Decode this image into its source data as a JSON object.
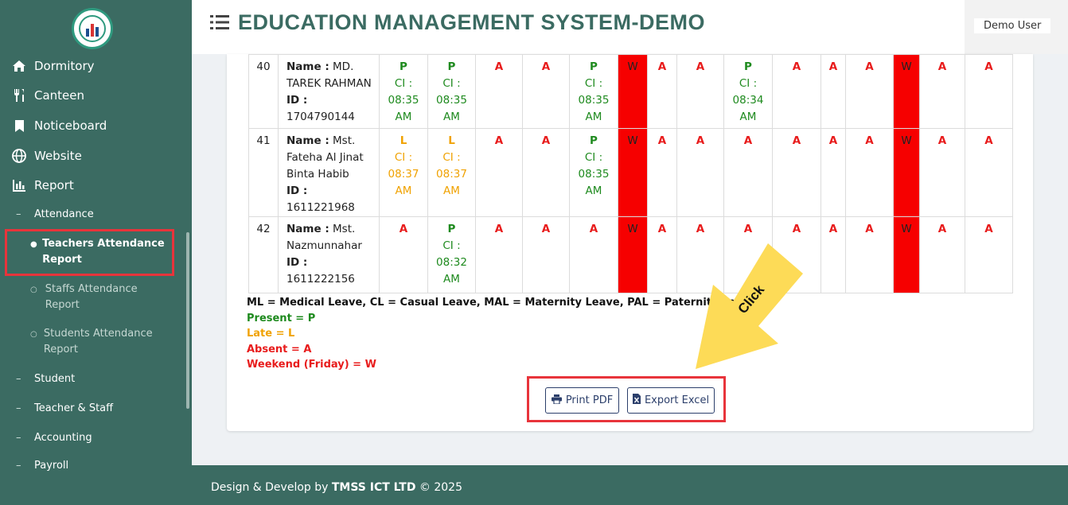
{
  "header": {
    "title": "EDUCATION MANAGEMENT SYSTEM-DEMO",
    "user": "Demo User"
  },
  "sidebar": {
    "items": [
      {
        "label": "Dormitory",
        "icon": "home-icon"
      },
      {
        "label": "Canteen",
        "icon": "utensils-icon"
      },
      {
        "label": "Noticeboard",
        "icon": "bookmark-icon"
      },
      {
        "label": "Website",
        "icon": "globe-icon"
      },
      {
        "label": "Report",
        "icon": "chart-icon"
      }
    ],
    "sub_attendance": "Attendance",
    "attendance_items": [
      "Teachers Attendance Report",
      "Staffs Attendance Report",
      "Students Attendance Report"
    ],
    "other_subs": [
      "Student",
      "Teacher & Staff",
      "Accounting",
      "Payroll"
    ]
  },
  "table": {
    "rows": [
      {
        "no": "40",
        "name_label": "Name :",
        "name": "MD. TAREK RAHMAN",
        "id_label": "ID :",
        "id": "1704790144",
        "cells": [
          [
            "P",
            "CI :",
            "08:35",
            "AM"
          ],
          [
            "P",
            "CI :",
            "08:35",
            "AM"
          ],
          [
            "A"
          ],
          [
            "A"
          ],
          [
            "P",
            "CI :",
            "08:35",
            "AM"
          ],
          [
            "W"
          ],
          [
            "A"
          ],
          [
            "A"
          ],
          [
            "P",
            "CI :",
            "08:34",
            "AM"
          ],
          [
            "A"
          ],
          [
            "A"
          ],
          [
            "A"
          ],
          [
            "W"
          ],
          [
            "A"
          ],
          [
            "A"
          ]
        ]
      },
      {
        "no": "41",
        "name_label": "Name :",
        "name": "Mst. Fateha Al Jinat Binta Habib",
        "id_label": "ID :",
        "id": "1611221968",
        "cells": [
          [
            "L",
            "CI :",
            "08:37",
            "AM"
          ],
          [
            "L",
            "CI :",
            "08:37",
            "AM"
          ],
          [
            "A"
          ],
          [
            "A"
          ],
          [
            "P",
            "CI :",
            "08:35",
            "AM"
          ],
          [
            "W"
          ],
          [
            "A"
          ],
          [
            "A"
          ],
          [
            "A"
          ],
          [
            "A"
          ],
          [
            "A"
          ],
          [
            "A"
          ],
          [
            "W"
          ],
          [
            "A"
          ],
          [
            "A"
          ]
        ]
      },
      {
        "no": "42",
        "name_label": "Name :",
        "name": "Mst. Nazmunnahar",
        "id_label": "ID :",
        "id": "1611222156",
        "cells": [
          [
            "A"
          ],
          [
            "P",
            "CI :",
            "08:32",
            "AM"
          ],
          [
            "A"
          ],
          [
            "A"
          ],
          [
            "A"
          ],
          [
            "W"
          ],
          [
            "A"
          ],
          [
            "A"
          ],
          [
            "A"
          ],
          [
            "A"
          ],
          [
            "A"
          ],
          [
            "A"
          ],
          [
            "W"
          ],
          [
            "A"
          ],
          [
            "A"
          ]
        ]
      }
    ]
  },
  "legend": {
    "leave": "ML = Medical Leave, CL = Casual Leave, MAL = Maternity Leave, PAL = Paternity Leave",
    "present": "Present = P",
    "late": "Late = L",
    "absent": "Absent = A",
    "weekend": "Weekend (Friday) = W"
  },
  "buttons": {
    "print": "Print PDF",
    "export": "Export Excel"
  },
  "annotation": {
    "text": "Click"
  },
  "footer": {
    "prefix": "Design & Develop by ",
    "company": "TMSS ICT LTD",
    "suffix": " © 2025"
  },
  "colors": {
    "primary": "#3b6b62",
    "present": "#1e8a1e",
    "late": "#f0a202",
    "absent": "#e81c1c",
    "weekend": "#f60000",
    "highlight": "#e8343b",
    "arrow": "#fddb57"
  }
}
